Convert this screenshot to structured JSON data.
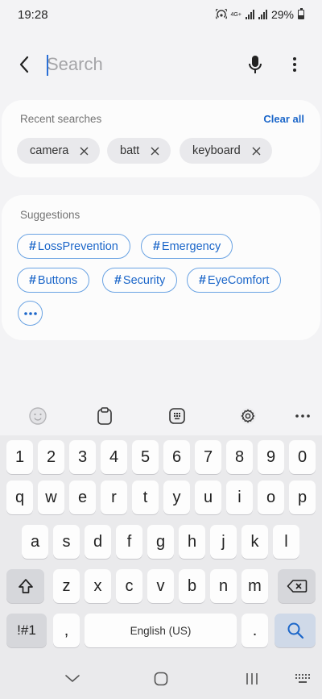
{
  "status": {
    "time": "19:28",
    "network": "4G+",
    "battery_percent": "29%"
  },
  "search": {
    "placeholder": "Search",
    "value": ""
  },
  "recent": {
    "title": "Recent searches",
    "clear_label": "Clear all",
    "items": [
      "camera",
      "batt",
      "keyboard"
    ]
  },
  "suggestions": {
    "title": "Suggestions",
    "hash_symbol": "#",
    "tags": [
      "LossPrevention",
      "Emergency",
      "Buttons",
      "Security",
      "EyeComfort"
    ]
  },
  "keyboard": {
    "row_numbers": [
      "1",
      "2",
      "3",
      "4",
      "5",
      "6",
      "7",
      "8",
      "9",
      "0"
    ],
    "row_top": [
      "q",
      "w",
      "e",
      "r",
      "t",
      "y",
      "u",
      "i",
      "o",
      "p"
    ],
    "row_middle": [
      "a",
      "s",
      "d",
      "f",
      "g",
      "h",
      "j",
      "k",
      "l"
    ],
    "row_bottom": [
      "z",
      "x",
      "c",
      "v",
      "b",
      "n",
      "m"
    ],
    "symbols_label": "!#1",
    "comma_label": ",",
    "space_label": "English (US)",
    "period_label": "."
  },
  "colors": {
    "accent": "#1b66c9",
    "chip_bg": "#e9e9ec",
    "card_bg": "#fcfcfc",
    "page_bg": "#f3f3f5"
  },
  "icons": [
    "back-arrow-icon",
    "mic-icon",
    "more-vertical-icon",
    "close-icon",
    "emoji-icon",
    "clipboard-icon",
    "keyboard-mode-icon",
    "settings-icon",
    "more-horizontal-icon",
    "shift-icon",
    "backspace-icon",
    "search-icon",
    "nav-back-icon",
    "nav-home-icon",
    "nav-recents-icon",
    "keyboard-hide-icon"
  ]
}
